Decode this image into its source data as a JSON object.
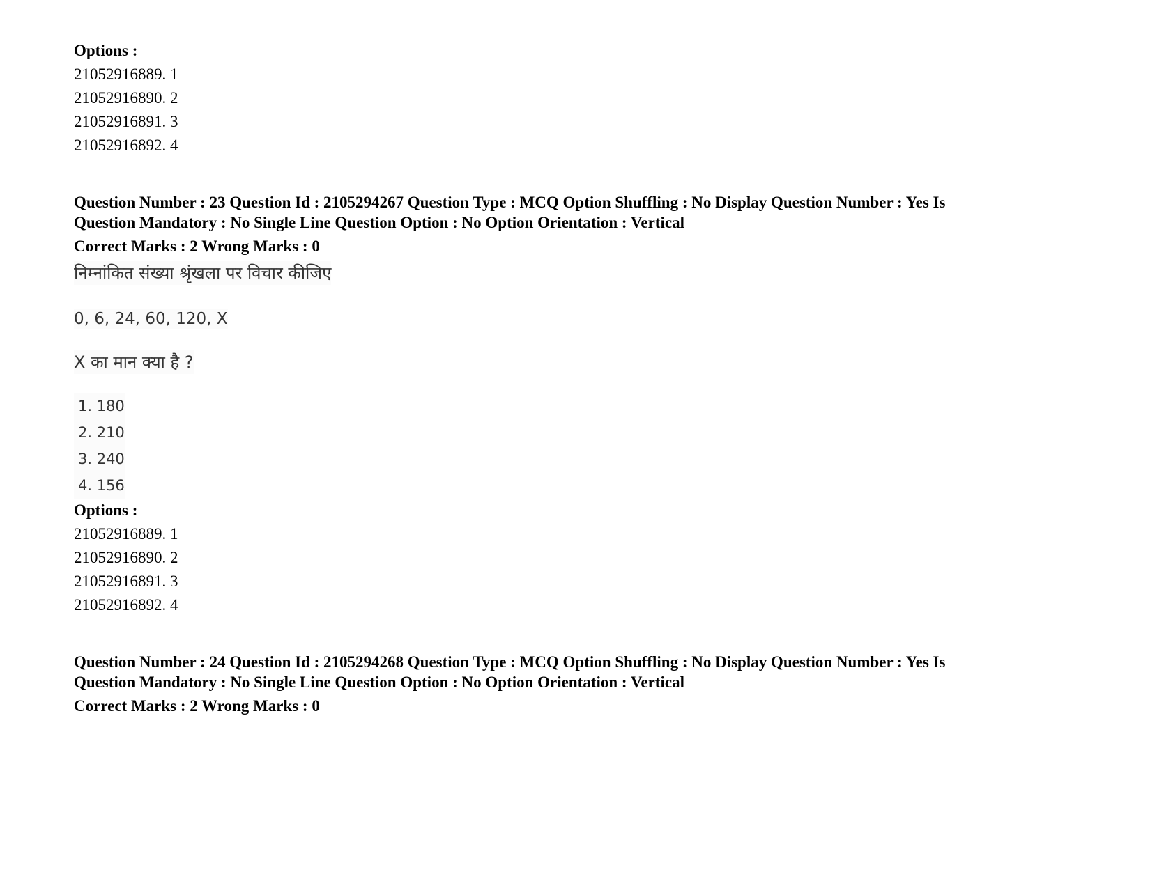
{
  "blocks": {
    "top_options": {
      "label": "Options :",
      "items": [
        "21052916889. 1",
        "21052916890. 2",
        "21052916891. 3",
        "21052916892. 4"
      ]
    },
    "q23": {
      "header_line1": "Question Number : 23 Question Id : 2105294267 Question Type : MCQ Option Shuffling : No Display Question Number : Yes Is",
      "header_line2": "Question Mandatory : No Single Line Question Option : No Option Orientation : Vertical",
      "marks": "Correct Marks : 2 Wrong Marks : 0",
      "question_text": "निम्नांकित संख्या श्रृंखला पर विचार कीजिए",
      "series": "0, 6, 24, 60, 120, X",
      "prompt": "X का मान क्या है ?",
      "choices": [
        "1. 180",
        "2. 210",
        "3. 240",
        "4. 156"
      ],
      "options_label": "Options :",
      "options": [
        "21052916889. 1",
        "21052916890. 2",
        "21052916891. 3",
        "21052916892. 4"
      ]
    },
    "q24": {
      "header_line1": "Question Number : 24 Question Id : 2105294268 Question Type : MCQ Option Shuffling : No Display Question Number : Yes Is",
      "header_line2": "Question Mandatory : No Single Line Question Option : No Option Orientation : Vertical",
      "marks": "Correct Marks : 2 Wrong Marks : 0"
    }
  }
}
